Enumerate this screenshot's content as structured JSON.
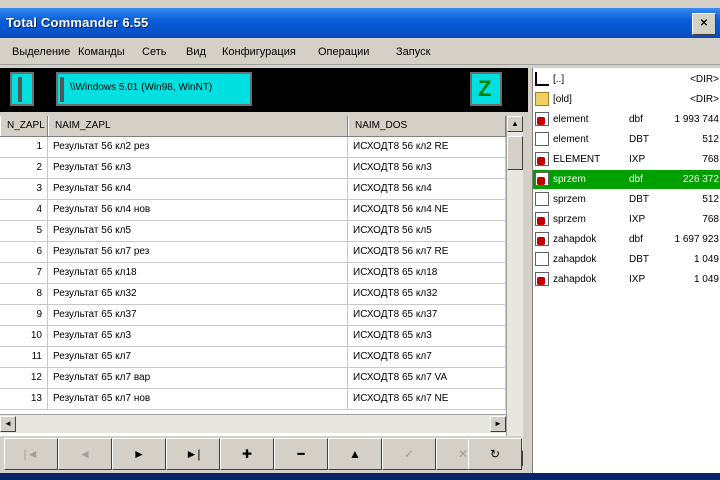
{
  "window": {
    "title": "Total Commander 6.55",
    "close_glyph": "✕"
  },
  "menu": [
    "Выделение",
    "Команды",
    "Сеть",
    "Вид",
    "Конфигурация",
    "Операции",
    "Запуск"
  ],
  "left_panel": {
    "path": "\\\\Windows 5.01 (Win98, WinNT)",
    "columns": [
      "N_ZAPL",
      "NAIM_ZAPL",
      "NAIM_DOS"
    ],
    "rows": [
      [
        "1",
        "Результат 56 кл2 рез",
        "ИСХОДТ8 56 кл2 RE"
      ],
      [
        "2",
        "Результат 56 кл3",
        "ИСХОДТ8 56 кл3"
      ],
      [
        "3",
        "Результат 56 кл4",
        "ИСХОДТ8 56 кл4"
      ],
      [
        "4",
        "Результат 56 кл4 нов",
        "ИСХОДТ8 56 кл4 NE"
      ],
      [
        "5",
        "Результат 56 кл5",
        "ИСХОДТ8 56 кл5"
      ],
      [
        "6",
        "Результат 56 кл7 рез",
        "ИСХОДТ8 56 кл7 RE"
      ],
      [
        "7",
        "Результат 65 кл18",
        "ИСХОДТ8 65 кл18"
      ],
      [
        "8",
        "Результат 65 кл32",
        "ИСХОДТ8 65 кл32"
      ],
      [
        "9",
        "Результат 65 кл37",
        "ИСХОДТ8 65 кл37"
      ],
      [
        "10",
        "Результат 65 кл3",
        "ИСХОДТ8 65 кл3"
      ],
      [
        "11",
        "Результат 65 кл7",
        "ИСХОДТ8 65 кл7"
      ],
      [
        "12",
        "Результат 65 кл7 вар",
        "ИСХОДТ8 65 кл7 VA"
      ],
      [
        "13",
        "Результат 65 кл7 нов",
        "ИСХОДТ8 65 кл7 NE"
      ]
    ],
    "navigator": {
      "first": "|◄",
      "prior": "◄",
      "next": "►",
      "last": "►|",
      "insert": "✚",
      "delete": "━",
      "edit": "▲",
      "post": "✓",
      "cancel": "✕",
      "refresh": "↻"
    }
  },
  "right_panel": {
    "files": [
      {
        "icon": "up-icon",
        "name": "[..]",
        "ext": "",
        "size": "<DIR>"
      },
      {
        "icon": "folder-icon",
        "name": "[old]",
        "ext": "",
        "size": "<DIR>"
      },
      {
        "icon": "dbf-icon",
        "name": "element",
        "ext": "dbf",
        "size": "1 993 744"
      },
      {
        "icon": "document-icon",
        "name": "element",
        "ext": "DBT",
        "size": "512"
      },
      {
        "icon": "dbf-icon",
        "name": "ELEMENT",
        "ext": "IXP",
        "size": "768"
      },
      {
        "icon": "dbf-icon",
        "name": "sprzem",
        "ext": "dbf",
        "size": "226 372"
      },
      {
        "icon": "document-icon",
        "name": "sprzem",
        "ext": "DBT",
        "size": "512"
      },
      {
        "icon": "dbf-icon",
        "name": "sprzem",
        "ext": "IXP",
        "size": "768"
      },
      {
        "icon": "dbf-icon",
        "name": "zahapdok",
        "ext": "dbf",
        "size": "1 697 923"
      },
      {
        "icon": "document-icon",
        "name": "zahapdok",
        "ext": "DBT",
        "size": "1 049"
      },
      {
        "icon": "dbf-icon",
        "name": "zahapdok",
        "ext": "IXP",
        "size": "1 049"
      }
    ],
    "selected_index": 5
  },
  "colors": {
    "titlebar": "#0a5fd8",
    "panel_bg": "#d4d0c8",
    "navbar_bg": "#000000",
    "cyan_widget": "#00e0e0",
    "selection": "#00a000"
  }
}
